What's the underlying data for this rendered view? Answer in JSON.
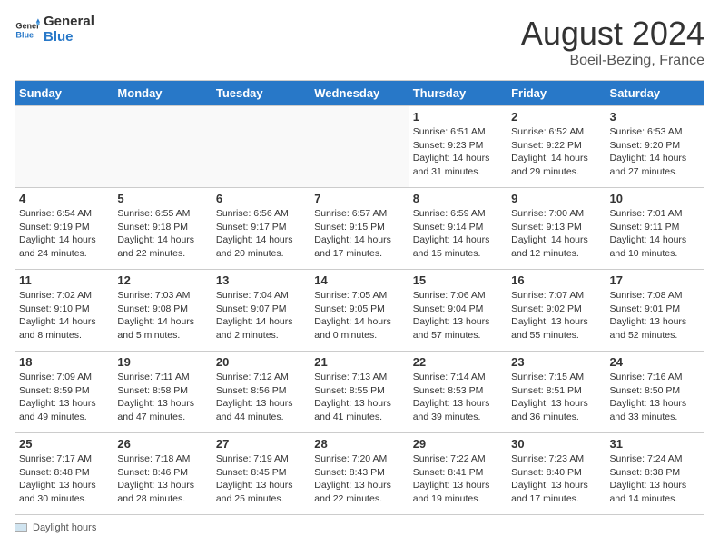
{
  "header": {
    "logo_general": "General",
    "logo_blue": "Blue",
    "month_year": "August 2024",
    "location": "Boeil-Bezing, France"
  },
  "days_of_week": [
    "Sunday",
    "Monday",
    "Tuesday",
    "Wednesday",
    "Thursday",
    "Friday",
    "Saturday"
  ],
  "footer": {
    "legend_label": "Daylight hours"
  },
  "weeks": [
    [
      {
        "day": "",
        "info": ""
      },
      {
        "day": "",
        "info": ""
      },
      {
        "day": "",
        "info": ""
      },
      {
        "day": "",
        "info": ""
      },
      {
        "day": "1",
        "info": "Sunrise: 6:51 AM\nSunset: 9:23 PM\nDaylight: 14 hours\nand 31 minutes."
      },
      {
        "day": "2",
        "info": "Sunrise: 6:52 AM\nSunset: 9:22 PM\nDaylight: 14 hours\nand 29 minutes."
      },
      {
        "day": "3",
        "info": "Sunrise: 6:53 AM\nSunset: 9:20 PM\nDaylight: 14 hours\nand 27 minutes."
      }
    ],
    [
      {
        "day": "4",
        "info": "Sunrise: 6:54 AM\nSunset: 9:19 PM\nDaylight: 14 hours\nand 24 minutes."
      },
      {
        "day": "5",
        "info": "Sunrise: 6:55 AM\nSunset: 9:18 PM\nDaylight: 14 hours\nand 22 minutes."
      },
      {
        "day": "6",
        "info": "Sunrise: 6:56 AM\nSunset: 9:17 PM\nDaylight: 14 hours\nand 20 minutes."
      },
      {
        "day": "7",
        "info": "Sunrise: 6:57 AM\nSunset: 9:15 PM\nDaylight: 14 hours\nand 17 minutes."
      },
      {
        "day": "8",
        "info": "Sunrise: 6:59 AM\nSunset: 9:14 PM\nDaylight: 14 hours\nand 15 minutes."
      },
      {
        "day": "9",
        "info": "Sunrise: 7:00 AM\nSunset: 9:13 PM\nDaylight: 14 hours\nand 12 minutes."
      },
      {
        "day": "10",
        "info": "Sunrise: 7:01 AM\nSunset: 9:11 PM\nDaylight: 14 hours\nand 10 minutes."
      }
    ],
    [
      {
        "day": "11",
        "info": "Sunrise: 7:02 AM\nSunset: 9:10 PM\nDaylight: 14 hours\nand 8 minutes."
      },
      {
        "day": "12",
        "info": "Sunrise: 7:03 AM\nSunset: 9:08 PM\nDaylight: 14 hours\nand 5 minutes."
      },
      {
        "day": "13",
        "info": "Sunrise: 7:04 AM\nSunset: 9:07 PM\nDaylight: 14 hours\nand 2 minutes."
      },
      {
        "day": "14",
        "info": "Sunrise: 7:05 AM\nSunset: 9:05 PM\nDaylight: 14 hours\nand 0 minutes."
      },
      {
        "day": "15",
        "info": "Sunrise: 7:06 AM\nSunset: 9:04 PM\nDaylight: 13 hours\nand 57 minutes."
      },
      {
        "day": "16",
        "info": "Sunrise: 7:07 AM\nSunset: 9:02 PM\nDaylight: 13 hours\nand 55 minutes."
      },
      {
        "day": "17",
        "info": "Sunrise: 7:08 AM\nSunset: 9:01 PM\nDaylight: 13 hours\nand 52 minutes."
      }
    ],
    [
      {
        "day": "18",
        "info": "Sunrise: 7:09 AM\nSunset: 8:59 PM\nDaylight: 13 hours\nand 49 minutes."
      },
      {
        "day": "19",
        "info": "Sunrise: 7:11 AM\nSunset: 8:58 PM\nDaylight: 13 hours\nand 47 minutes."
      },
      {
        "day": "20",
        "info": "Sunrise: 7:12 AM\nSunset: 8:56 PM\nDaylight: 13 hours\nand 44 minutes."
      },
      {
        "day": "21",
        "info": "Sunrise: 7:13 AM\nSunset: 8:55 PM\nDaylight: 13 hours\nand 41 minutes."
      },
      {
        "day": "22",
        "info": "Sunrise: 7:14 AM\nSunset: 8:53 PM\nDaylight: 13 hours\nand 39 minutes."
      },
      {
        "day": "23",
        "info": "Sunrise: 7:15 AM\nSunset: 8:51 PM\nDaylight: 13 hours\nand 36 minutes."
      },
      {
        "day": "24",
        "info": "Sunrise: 7:16 AM\nSunset: 8:50 PM\nDaylight: 13 hours\nand 33 minutes."
      }
    ],
    [
      {
        "day": "25",
        "info": "Sunrise: 7:17 AM\nSunset: 8:48 PM\nDaylight: 13 hours\nand 30 minutes."
      },
      {
        "day": "26",
        "info": "Sunrise: 7:18 AM\nSunset: 8:46 PM\nDaylight: 13 hours\nand 28 minutes."
      },
      {
        "day": "27",
        "info": "Sunrise: 7:19 AM\nSunset: 8:45 PM\nDaylight: 13 hours\nand 25 minutes."
      },
      {
        "day": "28",
        "info": "Sunrise: 7:20 AM\nSunset: 8:43 PM\nDaylight: 13 hours\nand 22 minutes."
      },
      {
        "day": "29",
        "info": "Sunrise: 7:22 AM\nSunset: 8:41 PM\nDaylight: 13 hours\nand 19 minutes."
      },
      {
        "day": "30",
        "info": "Sunrise: 7:23 AM\nSunset: 8:40 PM\nDaylight: 13 hours\nand 17 minutes."
      },
      {
        "day": "31",
        "info": "Sunrise: 7:24 AM\nSunset: 8:38 PM\nDaylight: 13 hours\nand 14 minutes."
      }
    ]
  ]
}
